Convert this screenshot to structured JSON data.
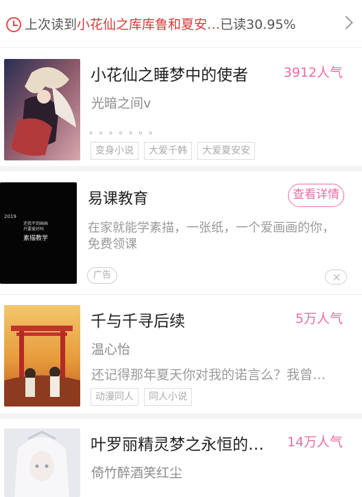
{
  "top_bar": {
    "prefix": "上次读到",
    "book_title": "小花仙之库库鲁和夏安…",
    "progress": "已读30.95%"
  },
  "books": [
    {
      "title": "小花仙之睡梦中的使者",
      "popularity": "3912人气",
      "author": "光暗之间v",
      "dots": "。。。。。。。",
      "tags": [
        "变身小说",
        "大爱千韩",
        "大爱夏安安"
      ]
    },
    {
      "title": "千与千寻后续",
      "popularity": "5万人气",
      "author": "温心怡",
      "description": "还记得那年夏天你对我的诺言么？我曾…",
      "tags": [
        "动漫同人",
        "同人小说"
      ]
    },
    {
      "title": "叶罗丽精灵梦之永恒的约…",
      "popularity": "14万人气",
      "author": "倚竹醉酒笑红尘"
    }
  ],
  "ad": {
    "title": "易课教育",
    "cta": "查看详情",
    "description_line1": "在家就能学素描，一张纸，一个爱画画的你，",
    "description_line2": "免费领课",
    "badge": "广告",
    "cover_year": "2019",
    "cover_tagline_1": "还我不到画画",
    "cover_tagline_2": "只要爱好吗",
    "cover_text": "素描教学"
  },
  "colors": {
    "accent_red": "#d33a3a",
    "accent_pink": "#e96ca4"
  }
}
